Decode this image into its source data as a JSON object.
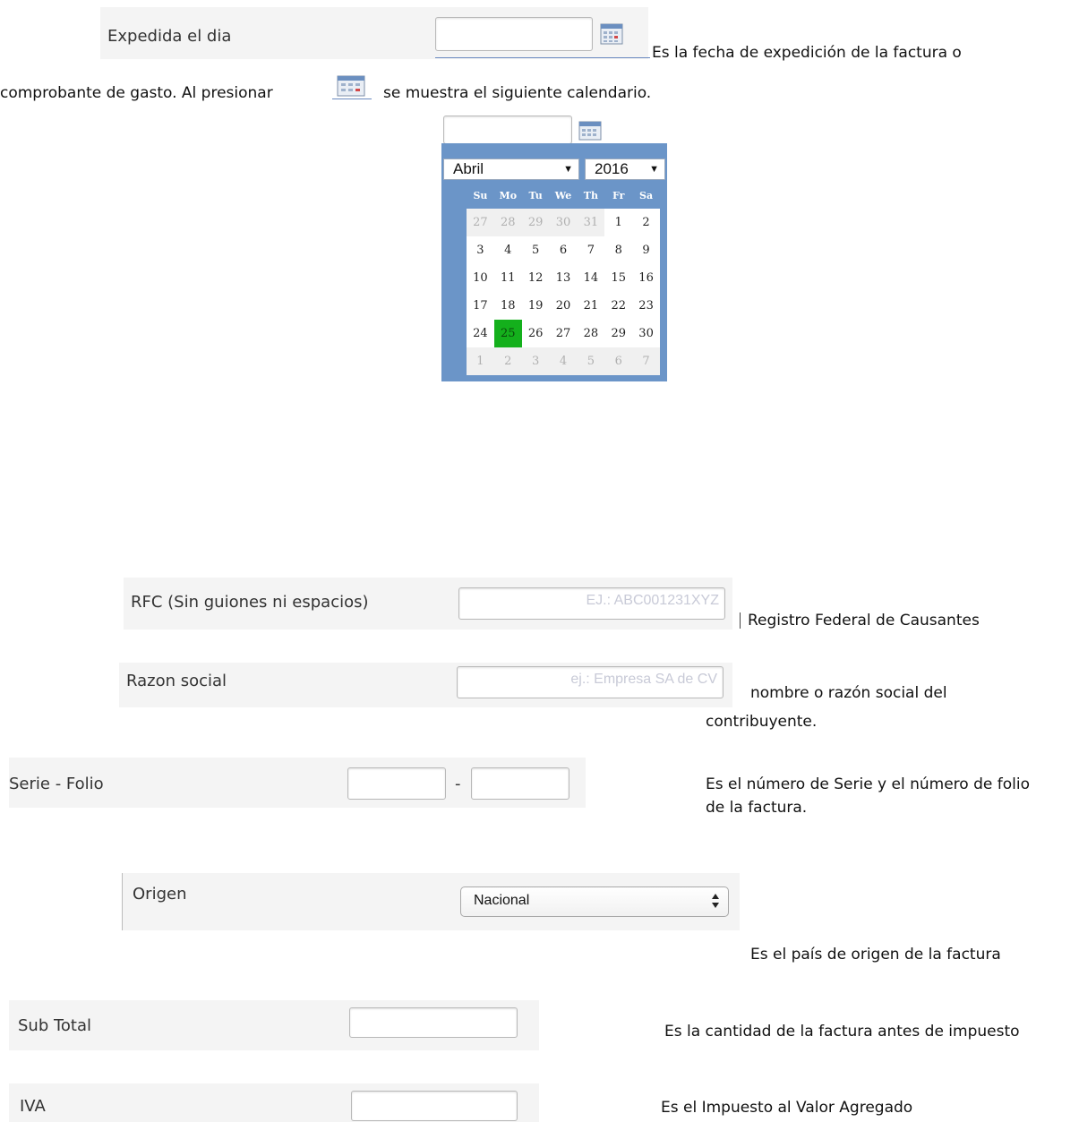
{
  "expedida": {
    "label": "Expedida el dia",
    "desc_line1": "Es la fecha de expedición de la factura o",
    "desc_line2_a": "comprobante de gasto. Al presionar",
    "desc_line2_b": "se muestra el siguiente calendario."
  },
  "calendar": {
    "month": "Abril",
    "year": "2016",
    "weekdays": [
      "Su",
      "Mo",
      "Tu",
      "We",
      "Th",
      "Fr",
      "Sa"
    ],
    "weeks": [
      [
        "27",
        "28",
        "29",
        "30",
        "31",
        "1",
        "2"
      ],
      [
        "3",
        "4",
        "5",
        "6",
        "7",
        "8",
        "9"
      ],
      [
        "10",
        "11",
        "12",
        "13",
        "14",
        "15",
        "16"
      ],
      [
        "17",
        "18",
        "19",
        "20",
        "21",
        "22",
        "23"
      ],
      [
        "24",
        "25",
        "26",
        "27",
        "28",
        "29",
        "30"
      ],
      [
        "1",
        "2",
        "3",
        "4",
        "5",
        "6",
        "7"
      ]
    ],
    "selected_day": "25",
    "selected_color": "#14b01c",
    "header_color": "#6b95c8"
  },
  "rfc": {
    "label": "RFC (Sin guiones ni espacios)",
    "placeholder": "EJ.: ABC001231XYZ",
    "desc": "Registro Federal de Causantes"
  },
  "razon": {
    "label": "Razon social",
    "placeholder": "ej.: Empresa SA de CV",
    "desc_line1": "nombre o razón social del",
    "desc_line2": "contribuyente."
  },
  "serie": {
    "label": "Serie - Folio",
    "separator": "-",
    "desc_line1": "Es el número de Serie y el número de folio",
    "desc_line2": "de la factura."
  },
  "origen": {
    "label": "Origen",
    "selected": "Nacional",
    "desc": "Es el país de origen de la factura"
  },
  "subtotal": {
    "label": "Sub Total",
    "desc": "Es la cantidad de la factura antes de impuesto"
  },
  "iva": {
    "label": "IVA",
    "desc": "Es el Impuesto al Valor Agregado"
  }
}
